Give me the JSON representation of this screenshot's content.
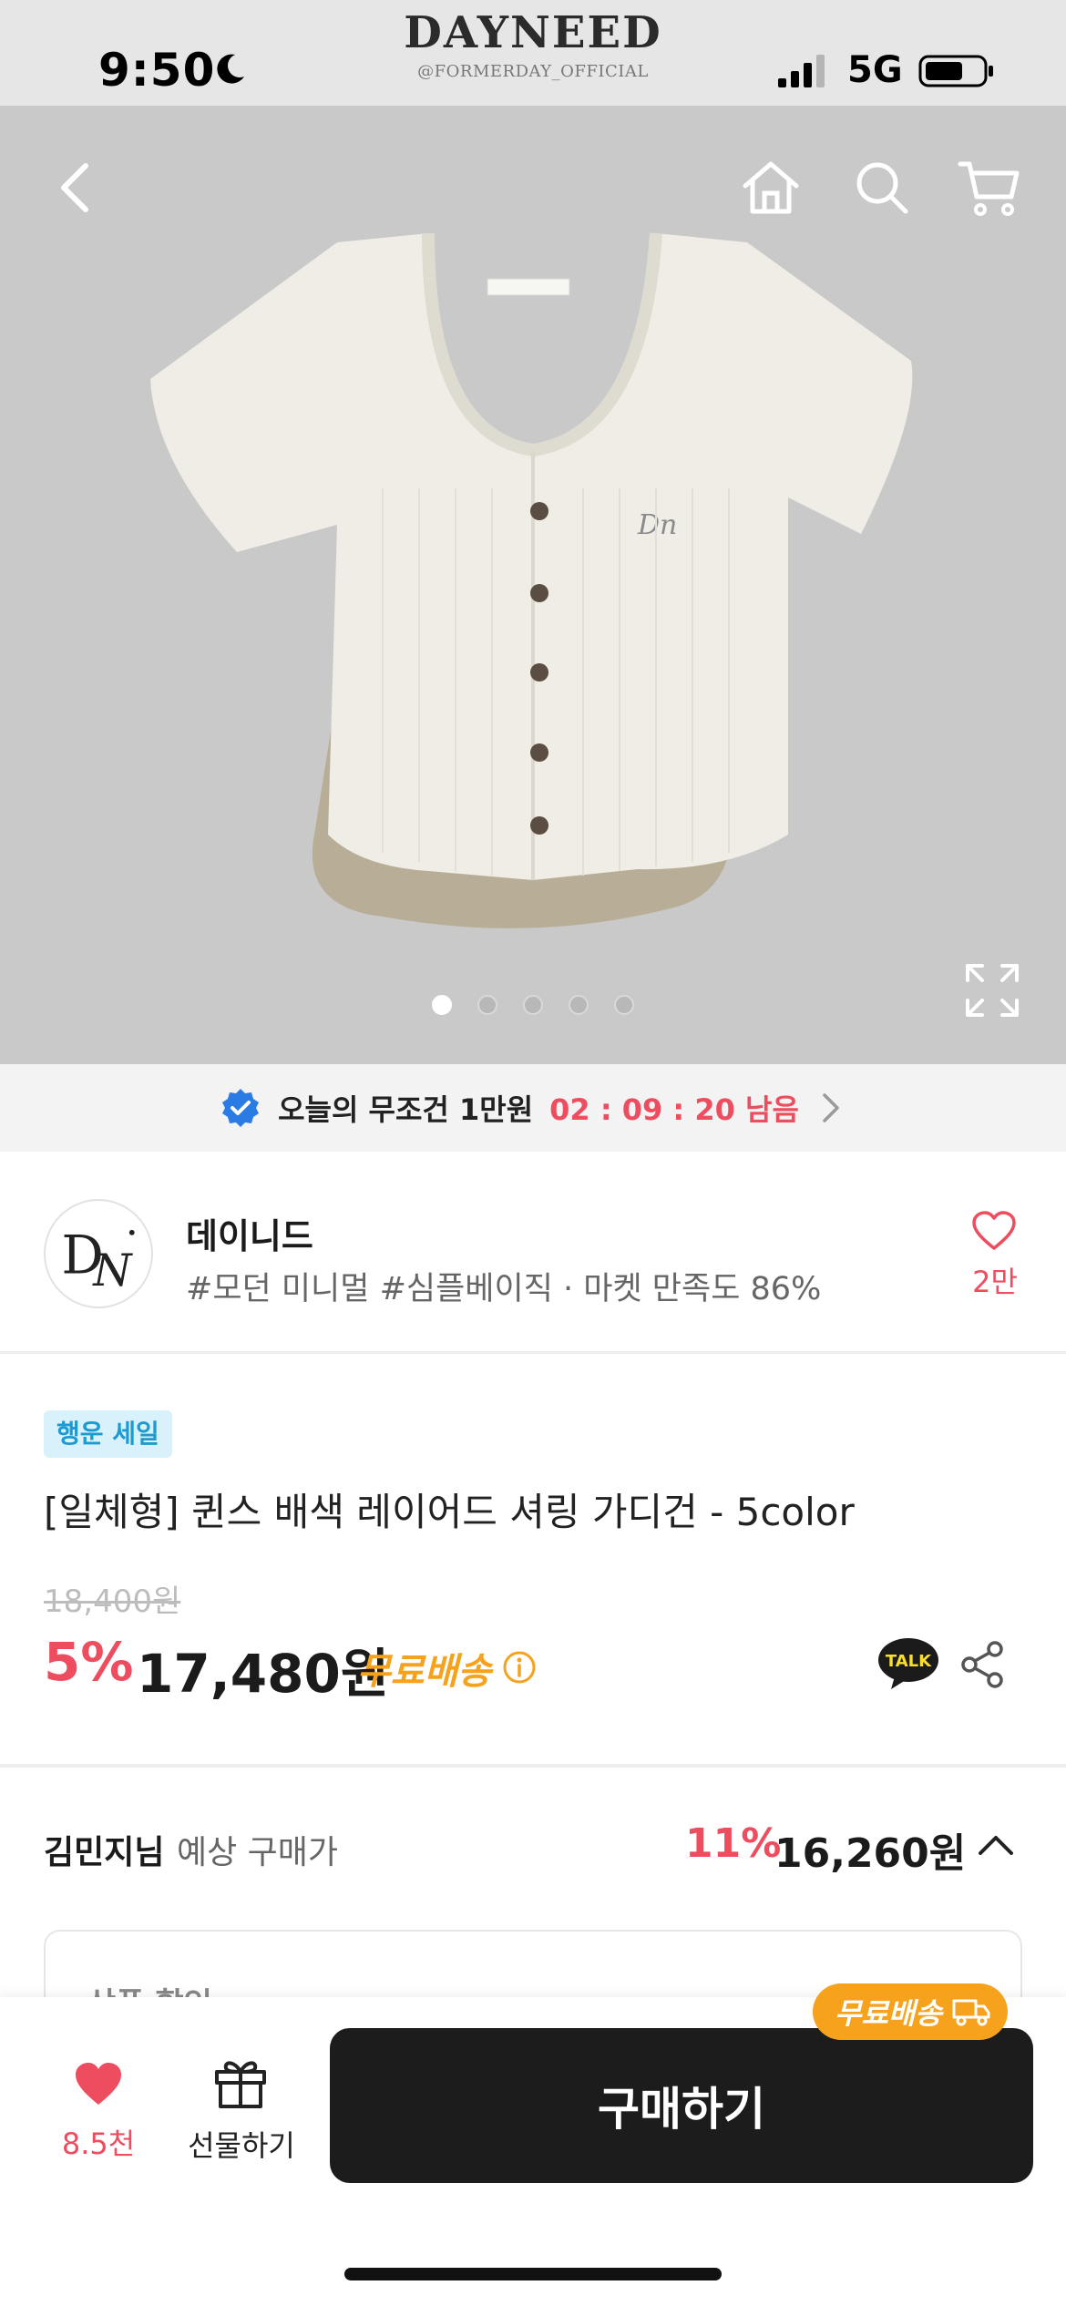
{
  "status_bar": {
    "time": "9:50",
    "network": "5G",
    "watermark_brand": "DAYNEED",
    "watermark_handle": "@FORMERDAY_OFFICIAL"
  },
  "hero": {
    "image_index": 1,
    "image_count": 5
  },
  "coupon_bar": {
    "text": "오늘의 무조건 1만원",
    "timer": "02 : 09 : 20 남음"
  },
  "store": {
    "name": "데이니드",
    "tags": "#모던 미니멀 #심플베이직 · 마켓 만족도 86%",
    "wish_count": "2만"
  },
  "product": {
    "badge": "행운 세일",
    "title": "[일체형] 퀸스 배색 레이어드 셔링 가디건 - 5color",
    "original_price": "18,400원",
    "discount_rate": "5%",
    "sale_price": "17,480원",
    "shipping": "무료배송",
    "talk_label": "TALK"
  },
  "expected": {
    "member": "김민지님",
    "label": "예상 구매가",
    "rate": "11%",
    "price": "16,260원",
    "card_label": "상품 할인"
  },
  "bottom_bar": {
    "like_count": "8.5천",
    "gift_label": "선물하기",
    "buy_label": "구매하기",
    "ship_pill": "무료배송"
  },
  "colors": {
    "accent_red": "#ee4d5f",
    "accent_orange": "#f7a21c",
    "badge_blue": "#1d9bd1",
    "buy_button": "#1c1c1c"
  }
}
